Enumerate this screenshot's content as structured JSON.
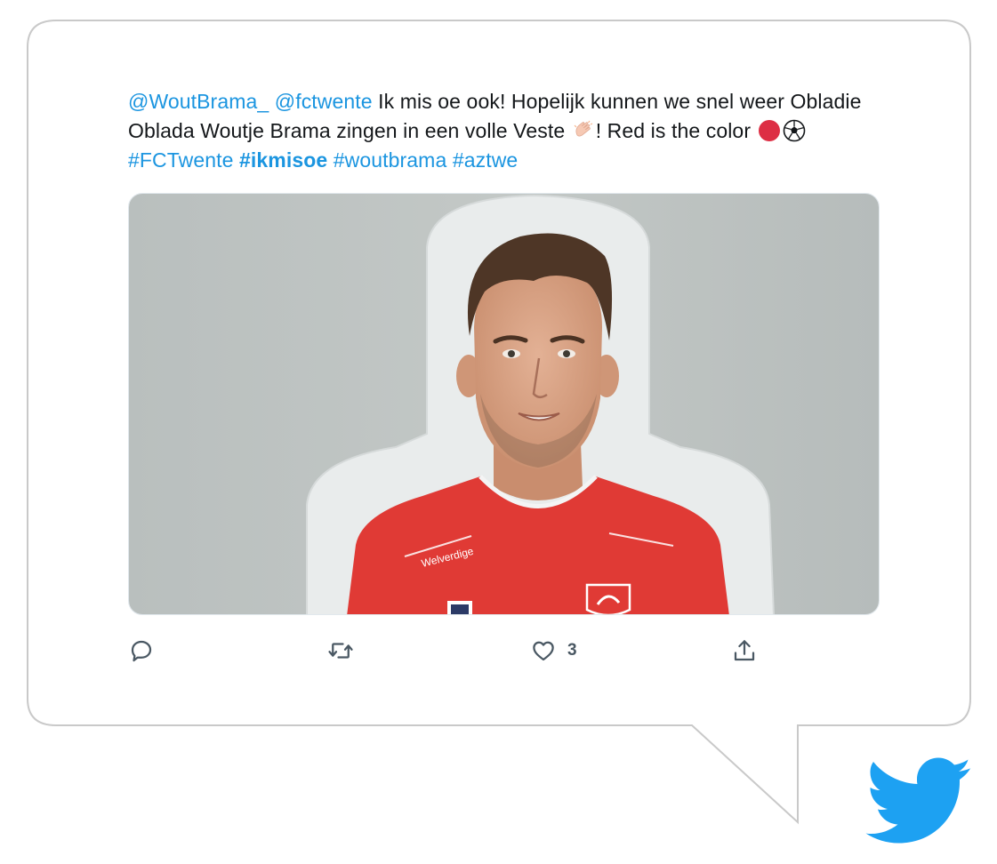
{
  "tweet": {
    "mention1": "@WoutBrama_",
    "mention2": "@fctwente",
    "text1": " Ik mis oe ook! Hopelijk kunnen we snel weer Obladie Oblada Woutje Brama zingen in een volle Veste ",
    "text2": "! Red is the color ",
    "hashtag1": "#FCTwente",
    "hashtag2": "#ikmisoe",
    "hashtag3": "#woutbrama",
    "hashtag4": "#aztwe",
    "emoji": [
      "clapping-hands",
      "red-circle",
      "soccer-ball"
    ]
  },
  "actions": {
    "reply_icon": "speech-bubble-icon",
    "retweet_icon": "retweet-icon",
    "like_icon": "heart-icon",
    "like_count": "3",
    "share_icon": "share-icon"
  },
  "colors": {
    "link": "#1b95e0",
    "text": "#14171a",
    "icon": "#4a5863",
    "twitter_blue": "#1da1f2",
    "bubble_border": "#c9c9c9"
  }
}
